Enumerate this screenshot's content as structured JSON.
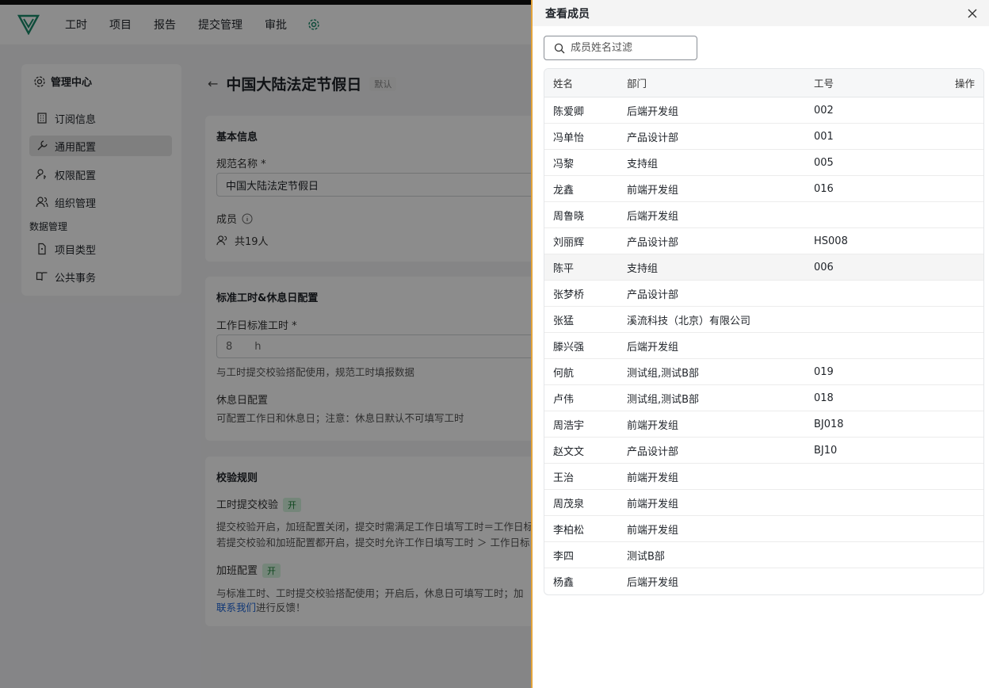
{
  "nav": {
    "items": [
      "工时",
      "项目",
      "报告",
      "提交管理",
      "审批"
    ]
  },
  "sidebar": {
    "title": "管理中心",
    "items": [
      {
        "label": "订阅信息",
        "icon": "building-icon"
      },
      {
        "label": "通用配置",
        "icon": "wrench-icon"
      },
      {
        "label": "权限配置",
        "icon": "user-key-icon"
      },
      {
        "label": "组织管理",
        "icon": "users-icon"
      }
    ],
    "section": "数据管理",
    "section_items": [
      {
        "label": "项目类型",
        "icon": "file-icon"
      },
      {
        "label": "公共事务",
        "icon": "book-icon"
      }
    ]
  },
  "main": {
    "title": "中国大陆法定节假日",
    "badge": "默认",
    "basic": {
      "title": "基本信息",
      "name_label": "规范名称 *",
      "name_value": "中国大陆法定节假日",
      "members_label": "成员",
      "members_count": "共19人"
    },
    "hours": {
      "title": "标准工时&休息日配置",
      "label": "工作日标准工时 *",
      "value": "8",
      "unit": "h",
      "hint": "与工时提交校验搭配使用，规范工时填报数据",
      "rest_title": "休息日配置",
      "rest_hint": "可配置工作日和休息日；注意：休息日默认不可填写工时"
    },
    "rules": {
      "title": "校验规则",
      "submit_label": "工时提交校验",
      "submit_badge": "开",
      "submit_hint1": "提交校验开启，加班配置关闭，提交时需满足工作日填写工时＝工作日标",
      "submit_hint2": "若提交校验和加班配置都开启，提交时允许工作日填写工时 ＞ 工作日标",
      "ot_label": "加班配置",
      "ot_badge": "开",
      "ot_hint": "与标准工时、工时提交校验搭配使用；开启后，休息日可填写工时；加",
      "contact_link": "联系我们",
      "contact_suffix": "进行反馈！"
    }
  },
  "drawer": {
    "title": "查看成员",
    "search_placeholder": "成员姓名过滤",
    "columns": [
      "姓名",
      "部门",
      "工号",
      "操作"
    ],
    "rows": [
      [
        "陈爱卿",
        "后端开发组",
        "002"
      ],
      [
        "冯单怡",
        "产品设计部",
        "001"
      ],
      [
        "冯黎",
        "支持组",
        "005"
      ],
      [
        "龙鑫",
        "前端开发组",
        "016"
      ],
      [
        "周鲁晓",
        "后端开发组",
        ""
      ],
      [
        "刘丽辉",
        "产品设计部",
        "HS008"
      ],
      [
        "陈平",
        "支持组",
        "006"
      ],
      [
        "张梦桥",
        "产品设计部",
        ""
      ],
      [
        "张猛",
        "溪流科技（北京）有限公司",
        ""
      ],
      [
        "滕兴强",
        "后端开发组",
        ""
      ],
      [
        "何航",
        "测试组,测试B部",
        "019"
      ],
      [
        "卢伟",
        "测试组,测试B部",
        "018"
      ],
      [
        "周浩宇",
        "前端开发组",
        "BJ018"
      ],
      [
        "赵文文",
        "产品设计部",
        "BJ10"
      ],
      [
        "王治",
        "前端开发组",
        ""
      ],
      [
        "周茂泉",
        "前端开发组",
        ""
      ],
      [
        "李柏松",
        "前端开发组",
        ""
      ],
      [
        "李四",
        "测试B部",
        ""
      ],
      [
        "杨鑫",
        "后端开发组",
        ""
      ]
    ],
    "highlight_row": 6
  }
}
